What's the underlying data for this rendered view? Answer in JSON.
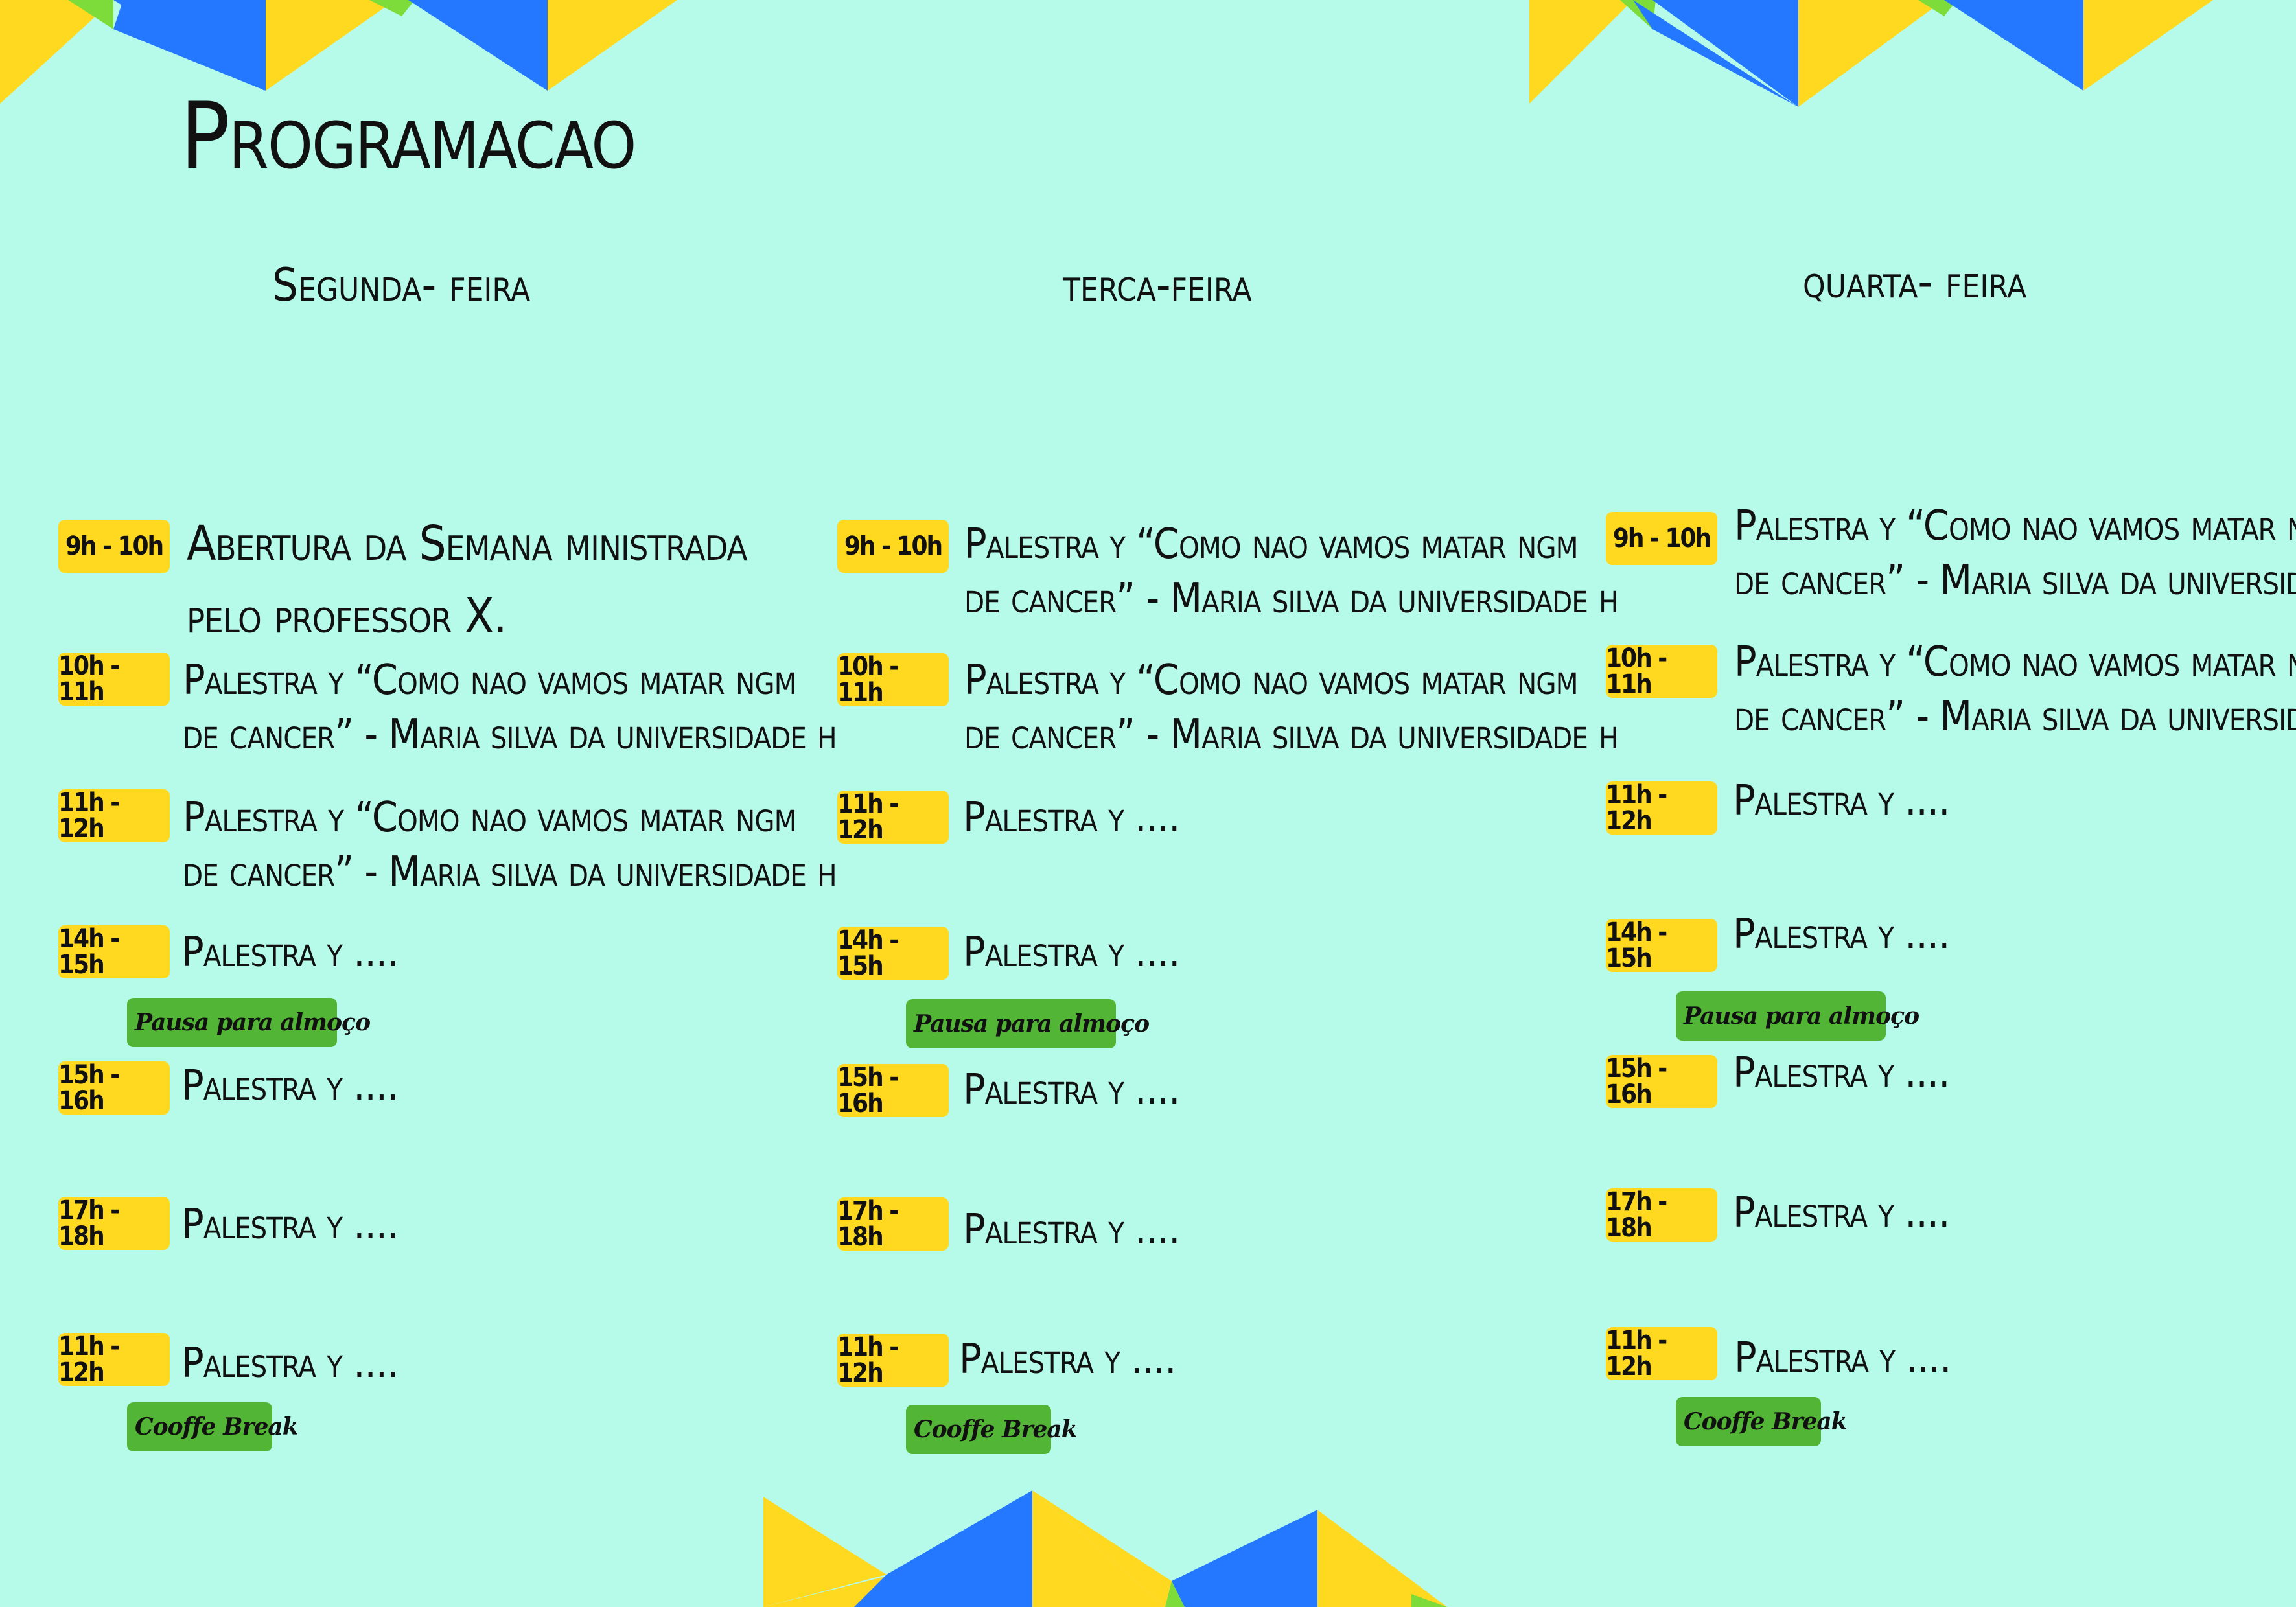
{
  "title": "Programacao",
  "colors": {
    "background": "#b6fbe9",
    "yellow": "#ffd820",
    "blue": "#2378ff",
    "green": "#52b535",
    "lime": "#7ddc3a"
  },
  "days": [
    {
      "name": "Segunda- feira",
      "sessions": [
        {
          "time": "9h - 10h",
          "talk": [
            "Abertura da Semana ministrada",
            "pelo professor X."
          ]
        },
        {
          "time": "10h - 11h",
          "talk": [
            "Palestra y “Como nao vamos matar ngm",
            "de cancer” - Maria silva da universidade h"
          ]
        },
        {
          "time": "11h - 12h",
          "talk": [
            "Palestra y “Como nao vamos matar ngm",
            "de cancer” - Maria silva da universidade h"
          ]
        },
        {
          "time": "14h - 15h",
          "talk": [
            "Palestra y ...."
          ]
        },
        {
          "time": "15h - 16h",
          "talk": [
            "Palestra y ...."
          ]
        },
        {
          "time": "17h - 18h",
          "talk": [
            "Palestra y ...."
          ]
        },
        {
          "time": "11h - 12h",
          "talk": [
            "Palestra y ...."
          ]
        }
      ],
      "lunch": "Pausa para almoço",
      "coffee": "Cooffe Break"
    },
    {
      "name": "terca-feira",
      "sessions": [
        {
          "time": "9h - 10h",
          "talk": [
            "Palestra y “Como nao vamos matar ngm",
            "de cancer” - Maria silva da universidade h"
          ]
        },
        {
          "time": "10h - 11h",
          "talk": [
            "Palestra y “Como nao vamos matar ngm",
            "de cancer” - Maria silva da universidade h"
          ]
        },
        {
          "time": "11h - 12h",
          "talk": [
            "Palestra y ...."
          ]
        },
        {
          "time": "14h - 15h",
          "talk": [
            "Palestra y ...."
          ]
        },
        {
          "time": "15h - 16h",
          "talk": [
            "Palestra y ...."
          ]
        },
        {
          "time": "17h - 18h",
          "talk": [
            "Palestra y ...."
          ]
        },
        {
          "time": "11h - 12h",
          "talk": [
            "Palestra y ...."
          ]
        }
      ],
      "lunch": "Pausa para almoço",
      "coffee": "Cooffe Break"
    },
    {
      "name": "quarta- feira",
      "sessions": [
        {
          "time": "9h - 10h",
          "talk": [
            "Palestra y “Como nao vamos matar ngm",
            "de cancer” - Maria silva da universidade h"
          ]
        },
        {
          "time": "10h - 11h",
          "talk": [
            "Palestra y “Como nao vamos matar ngm",
            "de cancer” - Maria silva da universidade h"
          ]
        },
        {
          "time": "11h - 12h",
          "talk": [
            "Palestra y ...."
          ]
        },
        {
          "time": "14h - 15h",
          "talk": [
            "Palestra y ...."
          ]
        },
        {
          "time": "15h - 16h",
          "talk": [
            "Palestra y ...."
          ]
        },
        {
          "time": "17h - 18h",
          "talk": [
            "Palestra y ...."
          ]
        },
        {
          "time": "11h - 12h",
          "talk": [
            "Palestra y ...."
          ]
        }
      ],
      "lunch": "Pausa para almoço",
      "coffee": "Cooffe Break"
    }
  ]
}
